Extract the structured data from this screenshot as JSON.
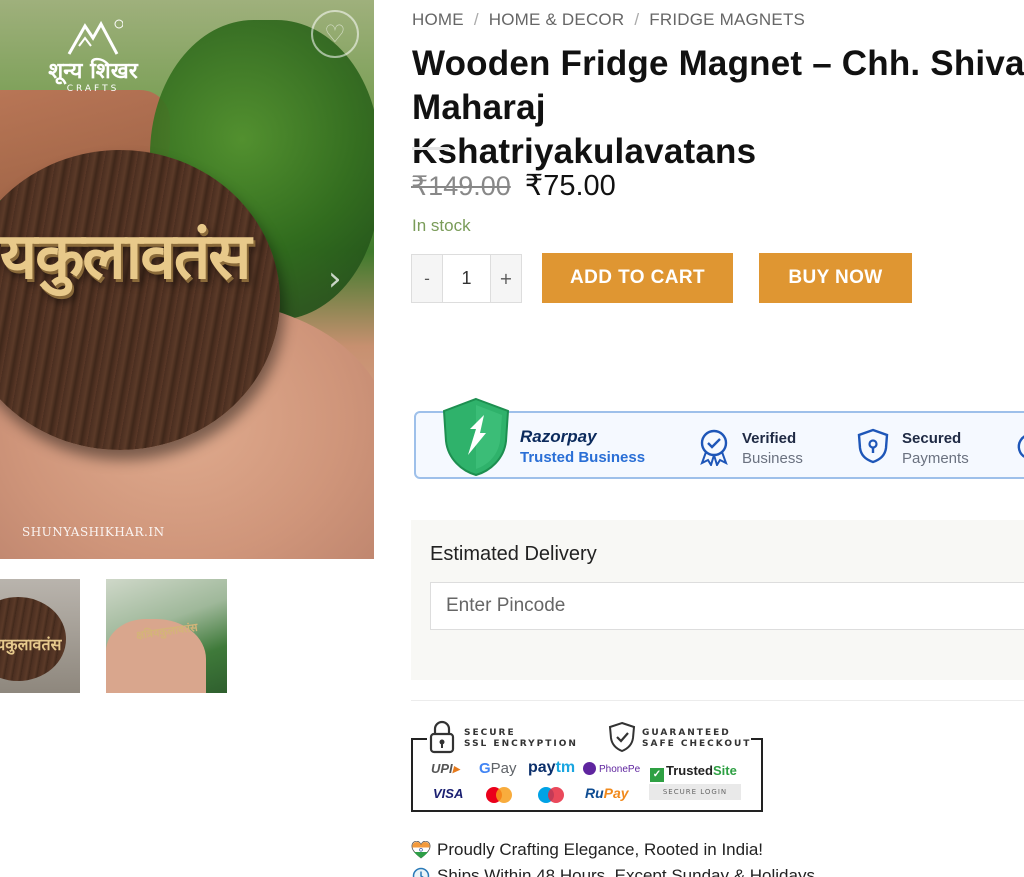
{
  "gallery": {
    "logo_brand": "शून्य शिखर",
    "logo_sub": "CRAFTS",
    "carved_text": "यकुलावतंस",
    "watermark": "SHUNYASHIKHAR.IN",
    "wishlist_icon": "heart-icon",
    "next_icon": "chevron-right-icon",
    "thumbnails": [
      {
        "text": "यकुलावतंस"
      },
      {
        "text": "क्षत्रियकुलावतंस"
      }
    ]
  },
  "breadcrumb": {
    "items": [
      "HOME",
      "HOME & DECOR",
      "FRIDGE MAGNETS"
    ],
    "separator": "/"
  },
  "product": {
    "title": "Wooden Fridge Magnet – Chh. Shivaji Maharaj\nKshatriyakulavatans",
    "price_old": "₹149.00",
    "price_new": "₹75.00",
    "stock": "In stock",
    "quantity": "1",
    "minus_label": "-",
    "plus_label": "+",
    "add_to_cart_label": "ADD TO CART",
    "buy_now_label": "BUY NOW",
    "accent_color": "#df9632"
  },
  "trust_badge": {
    "razorpay_title": "Razorpay",
    "razorpay_sub": "Trusted Business",
    "verified_l1": "Verified",
    "verified_l2": "Business",
    "secured_l1": "Secured",
    "secured_l2": "Payments"
  },
  "delivery": {
    "label": "Estimated Delivery",
    "pincode_placeholder": "Enter Pincode"
  },
  "secure_checkout": {
    "ssl_text": "SECURE\nSSL ENCRYPTION",
    "safe_text": "GUARANTEED\nSAFE CHECKOUT",
    "upi": "UPI",
    "gpay_g": "G",
    "gpay_rest": "Pay",
    "paytm_a": "pay",
    "paytm_b": "tm",
    "phonepe": "PhonePe",
    "trustedsite_a": "Trusted",
    "trustedsite_b": "Site",
    "visa": "VISA",
    "rupay_a": "Ru",
    "rupay_b": "Pay",
    "secure_login": "SECURE LOGIN"
  },
  "features": [
    {
      "text": "Proudly Crafting Elegance, Rooted in India!"
    },
    {
      "text": "Ships Within 48 Hours, Except Sunday & Holidays"
    }
  ]
}
